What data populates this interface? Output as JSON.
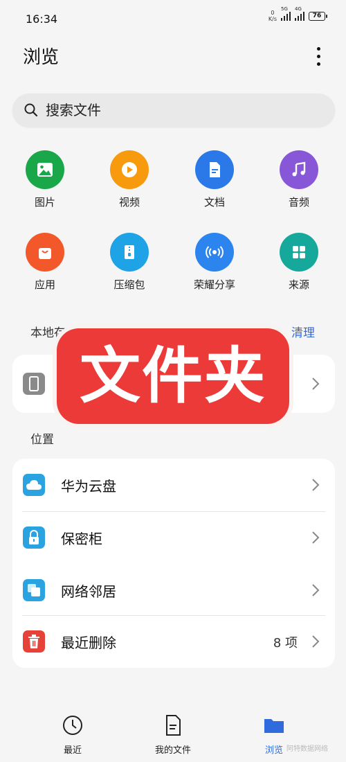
{
  "status_bar": {
    "time": "16:34",
    "net_speed_value": "0",
    "net_speed_unit": "K/s",
    "sim1_label": "5G",
    "sim2_label": "4G",
    "battery": "76"
  },
  "header": {
    "title": "浏览"
  },
  "search": {
    "placeholder": "搜索文件"
  },
  "categories": [
    {
      "label": "图片",
      "icon": "image-icon",
      "color": "#1aa74a"
    },
    {
      "label": "视频",
      "icon": "video-icon",
      "color": "#f79a0e"
    },
    {
      "label": "文档",
      "icon": "document-icon",
      "color": "#2b78e8"
    },
    {
      "label": "音频",
      "icon": "music-icon",
      "color": "#8857d8"
    },
    {
      "label": "应用",
      "icon": "shopping-bag-icon",
      "color": "#f2582a"
    },
    {
      "label": "压缩包",
      "icon": "zip-icon",
      "color": "#1ea3e6"
    },
    {
      "label": "荣耀分享",
      "icon": "wireless-share-icon",
      "color": "#2c84ee"
    },
    {
      "label": "来源",
      "icon": "grid-icon",
      "color": "#17a89c"
    }
  ],
  "local_storage": {
    "label": "本地存储",
    "clean": "清理"
  },
  "location": {
    "label": "位置",
    "items": [
      {
        "label": "华为云盘",
        "icon": "cloud-icon",
        "color": "#2aa3e0"
      },
      {
        "label": "保密柜",
        "icon": "lock-icon",
        "color": "#2aa3e0"
      },
      {
        "label": "网络邻居",
        "icon": "network-neighbor-icon",
        "color": "#2aa3e0"
      },
      {
        "label": "最近删除",
        "icon": "trash-icon",
        "color": "#e5423a",
        "count": "8 项"
      }
    ]
  },
  "overlay": {
    "text": "文件夹"
  },
  "bottom_nav": {
    "recent": "最近",
    "my_files": "我的文件",
    "browse": "浏览"
  },
  "watermark": "阿特数据网络",
  "colors": {
    "accent": "#2f6bdc",
    "overlay_red": "#ec3a38"
  }
}
